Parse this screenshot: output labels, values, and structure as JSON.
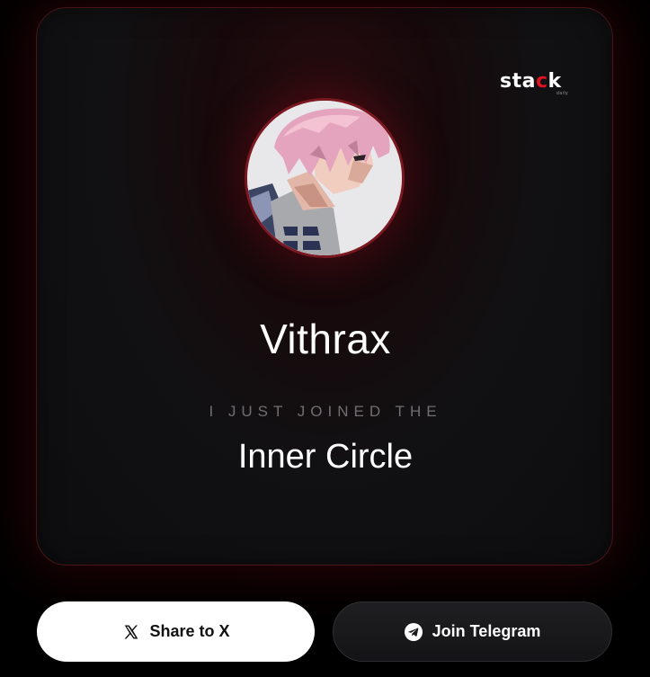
{
  "brand": {
    "logo_text_1": "sta",
    "logo_text_2": "c",
    "logo_text_3": "k",
    "logo_sub": "daily",
    "accent_color": "#e0121f"
  },
  "profile": {
    "username": "Vithrax",
    "avatar_icon": "anime-avatar"
  },
  "message": {
    "tagline": "I JUST JOINED THE",
    "group_name": "Inner Circle"
  },
  "actions": {
    "share_label": "Share to X",
    "share_icon": "x-logo-icon",
    "telegram_label": "Join Telegram",
    "telegram_icon": "telegram-icon"
  },
  "colors": {
    "background": "#000000",
    "card_border": "#4a1419",
    "primary_button": "#ffffff",
    "secondary_button": "#1a1a1d"
  }
}
